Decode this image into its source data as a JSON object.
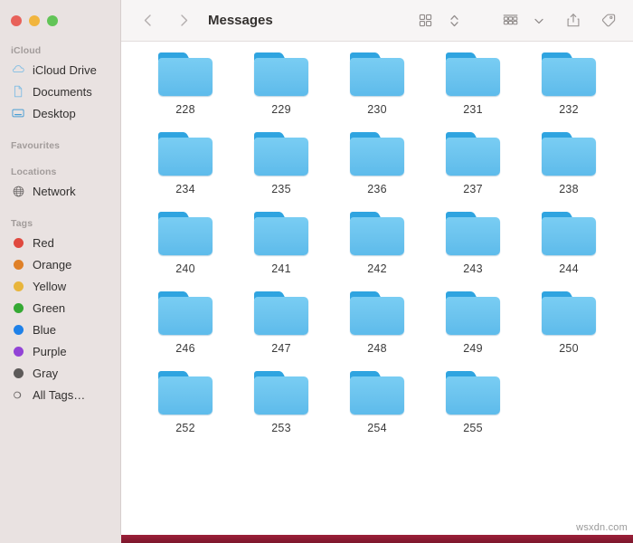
{
  "window": {
    "title": "Messages",
    "traffic_lights": [
      {
        "name": "close",
        "color": "#e8615a"
      },
      {
        "name": "minimize",
        "color": "#f1b53e"
      },
      {
        "name": "maximize",
        "color": "#62c457"
      }
    ]
  },
  "toolbar": {
    "back_label": "‹",
    "forward_label": "›",
    "icons": [
      {
        "name": "grid-view-icon",
        "label": "Icon view"
      },
      {
        "name": "sort-chevrons-icon",
        "label": "Sort"
      },
      {
        "name": "group-by-icon",
        "label": "Group items"
      },
      {
        "name": "chevron-down-icon",
        "label": "More"
      },
      {
        "name": "share-icon",
        "label": "Share"
      },
      {
        "name": "tag-icon",
        "label": "Tags"
      }
    ]
  },
  "sidebar": {
    "sections": [
      {
        "title": "iCloud",
        "items": [
          {
            "label": "iCloud Drive",
            "icon": "cloud-icon",
            "color": "#7fbde4"
          },
          {
            "label": "Documents",
            "icon": "document-icon",
            "color": "#7fbde4"
          },
          {
            "label": "Desktop",
            "icon": "desktop-icon",
            "color": "#4a9ed4"
          }
        ]
      },
      {
        "title": "Favourites",
        "items": []
      },
      {
        "title": "Locations",
        "items": [
          {
            "label": "Network",
            "icon": "globe-icon",
            "color": "#6e6a69"
          }
        ]
      },
      {
        "title": "Tags",
        "items": [
          {
            "label": "Red",
            "icon": "tag-dot-icon",
            "color": "#e0493f"
          },
          {
            "label": "Orange",
            "icon": "tag-dot-icon",
            "color": "#df8027"
          },
          {
            "label": "Yellow",
            "icon": "tag-dot-icon",
            "color": "#e8b53c"
          },
          {
            "label": "Green",
            "icon": "tag-dot-icon",
            "color": "#35a934"
          },
          {
            "label": "Blue",
            "icon": "tag-dot-icon",
            "color": "#1f81e8"
          },
          {
            "label": "Purple",
            "icon": "tag-dot-icon",
            "color": "#9243d6"
          },
          {
            "label": "Gray",
            "icon": "tag-dot-icon",
            "color": "#5d5a59"
          },
          {
            "label": "All Tags…",
            "icon": "all-tags-icon",
            "color": "#6e6a69"
          }
        ]
      }
    ]
  },
  "main": {
    "view": "icon-grid",
    "columns": 5,
    "folders": [
      {
        "name": "228"
      },
      {
        "name": "229"
      },
      {
        "name": "230"
      },
      {
        "name": "231"
      },
      {
        "name": "232"
      },
      {
        "name": "234"
      },
      {
        "name": "235"
      },
      {
        "name": "236"
      },
      {
        "name": "237"
      },
      {
        "name": "238"
      },
      {
        "name": "240"
      },
      {
        "name": "241"
      },
      {
        "name": "242"
      },
      {
        "name": "243"
      },
      {
        "name": "244"
      },
      {
        "name": "246"
      },
      {
        "name": "247"
      },
      {
        "name": "248"
      },
      {
        "name": "249"
      },
      {
        "name": "250"
      },
      {
        "name": "252"
      },
      {
        "name": "253"
      },
      {
        "name": "254"
      },
      {
        "name": "255"
      }
    ]
  },
  "watermark": {
    "text": "wsxdn.com"
  },
  "colors": {
    "folder_body": "#6bc3ee",
    "folder_tab": "#2fa4e0",
    "sidebar_bg": "#e9e2e1",
    "toolbar_bg": "#f7f5f5",
    "bottom_bar": "#8e1c35"
  }
}
